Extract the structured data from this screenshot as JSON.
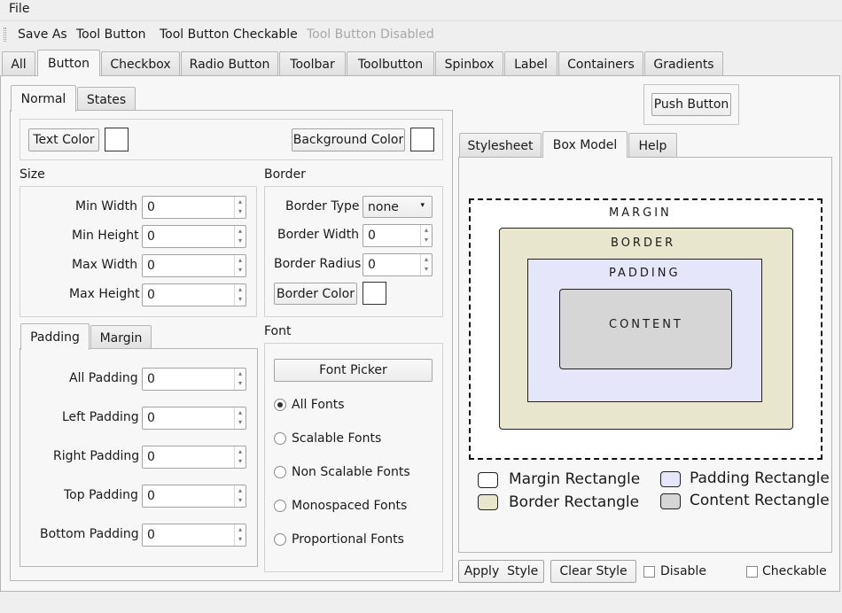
{
  "menubar": {
    "file": "File"
  },
  "toolbar": {
    "save_as": "Save As",
    "tool_button": "Tool Button",
    "tool_button_checkable": "Tool Button Checkable",
    "tool_button_disabled": "Tool Button Disabled"
  },
  "main_tabs": [
    "All",
    "Button",
    "Checkbox",
    "Radio Button",
    "Toolbar",
    "Toolbutton",
    "Spinbox",
    "Label",
    "Containers",
    "Gradients"
  ],
  "inner_tabs": [
    "Normal",
    "States"
  ],
  "colors_row": {
    "text_color": "Text Color",
    "background_color": "Background Color"
  },
  "size": {
    "title": "Size",
    "rows": [
      {
        "label": "Min Width",
        "value": "0"
      },
      {
        "label": "Min Height",
        "value": "0"
      },
      {
        "label": "Max Width",
        "value": "0"
      },
      {
        "label": "Max Height",
        "value": "0"
      }
    ]
  },
  "border": {
    "title": "Border",
    "type_label": "Border Type",
    "type_value": "none",
    "width_label": "Border Width",
    "width_value": "0",
    "radius_label": "Border Radius",
    "radius_value": "0",
    "color_button": "Border Color"
  },
  "spacing_tabs": [
    "Padding",
    "Margin"
  ],
  "padding": {
    "rows": [
      {
        "label": "All Padding",
        "value": "0"
      },
      {
        "label": "Left Padding",
        "value": "0"
      },
      {
        "label": "Right Padding",
        "value": "0"
      },
      {
        "label": "Top Padding",
        "value": "0"
      },
      {
        "label": "Bottom Padding",
        "value": "0"
      }
    ]
  },
  "font": {
    "title": "Font",
    "picker": "Font Picker",
    "options": [
      "All Fonts",
      "Scalable Fonts",
      "Non Scalable Fonts",
      "Monospaced Fonts",
      "Proportional Fonts"
    ],
    "selected": "All Fonts"
  },
  "preview": {
    "push_button": "Push Button"
  },
  "right_tabs": [
    "Stylesheet",
    "Box Model",
    "Help"
  ],
  "box_model": {
    "margin": "MARGIN",
    "border": "BORDER",
    "padding": "PADDING",
    "content": "CONTENT",
    "legend": {
      "margin": "Margin Rectangle",
      "padding": "Padding Rectangle",
      "border": "Border Rectangle",
      "content": "Content Rectangle"
    },
    "colors": {
      "border": "#e8e6cc",
      "padding": "#e6e6fa",
      "content": "#d6d6d6",
      "margin": "#ffffff"
    }
  },
  "bottom": {
    "apply": "Apply  Style",
    "clear": "Clear Style",
    "disable": "Disable",
    "checkable": "Checkable"
  }
}
